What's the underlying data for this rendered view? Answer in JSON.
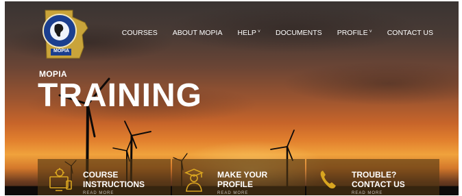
{
  "brand": {
    "logo_text": "MOPIA",
    "logo_ring_text": "Manitoba Operators"
  },
  "nav": {
    "items": [
      {
        "label": "COURSES",
        "has_dropdown": false
      },
      {
        "label": "ABOUT MOPIA",
        "has_dropdown": false
      },
      {
        "label": "HELP",
        "has_dropdown": true
      },
      {
        "label": "DOCUMENTS",
        "has_dropdown": false
      },
      {
        "label": "PROFILE",
        "has_dropdown": true
      },
      {
        "label": "CONTACT US",
        "has_dropdown": false
      }
    ]
  },
  "hero": {
    "eyebrow": "MOPIA",
    "title": "TRAINING"
  },
  "cards": [
    {
      "line1": "COURSE",
      "line2": "INSTRUCTIONS",
      "more": "READ MORE",
      "icon": "gear-computer-icon"
    },
    {
      "line1": "MAKE YOUR",
      "line2": "PROFILE",
      "more": "READ MORE",
      "icon": "graduate-icon"
    },
    {
      "line1": "TROUBLE?",
      "line2": "CONTACT US",
      "more": "READ MORE",
      "icon": "phone-icon"
    }
  ],
  "colors": {
    "accent": "#d9a520",
    "card_bg": "#50371488",
    "text": "#ffffff"
  }
}
